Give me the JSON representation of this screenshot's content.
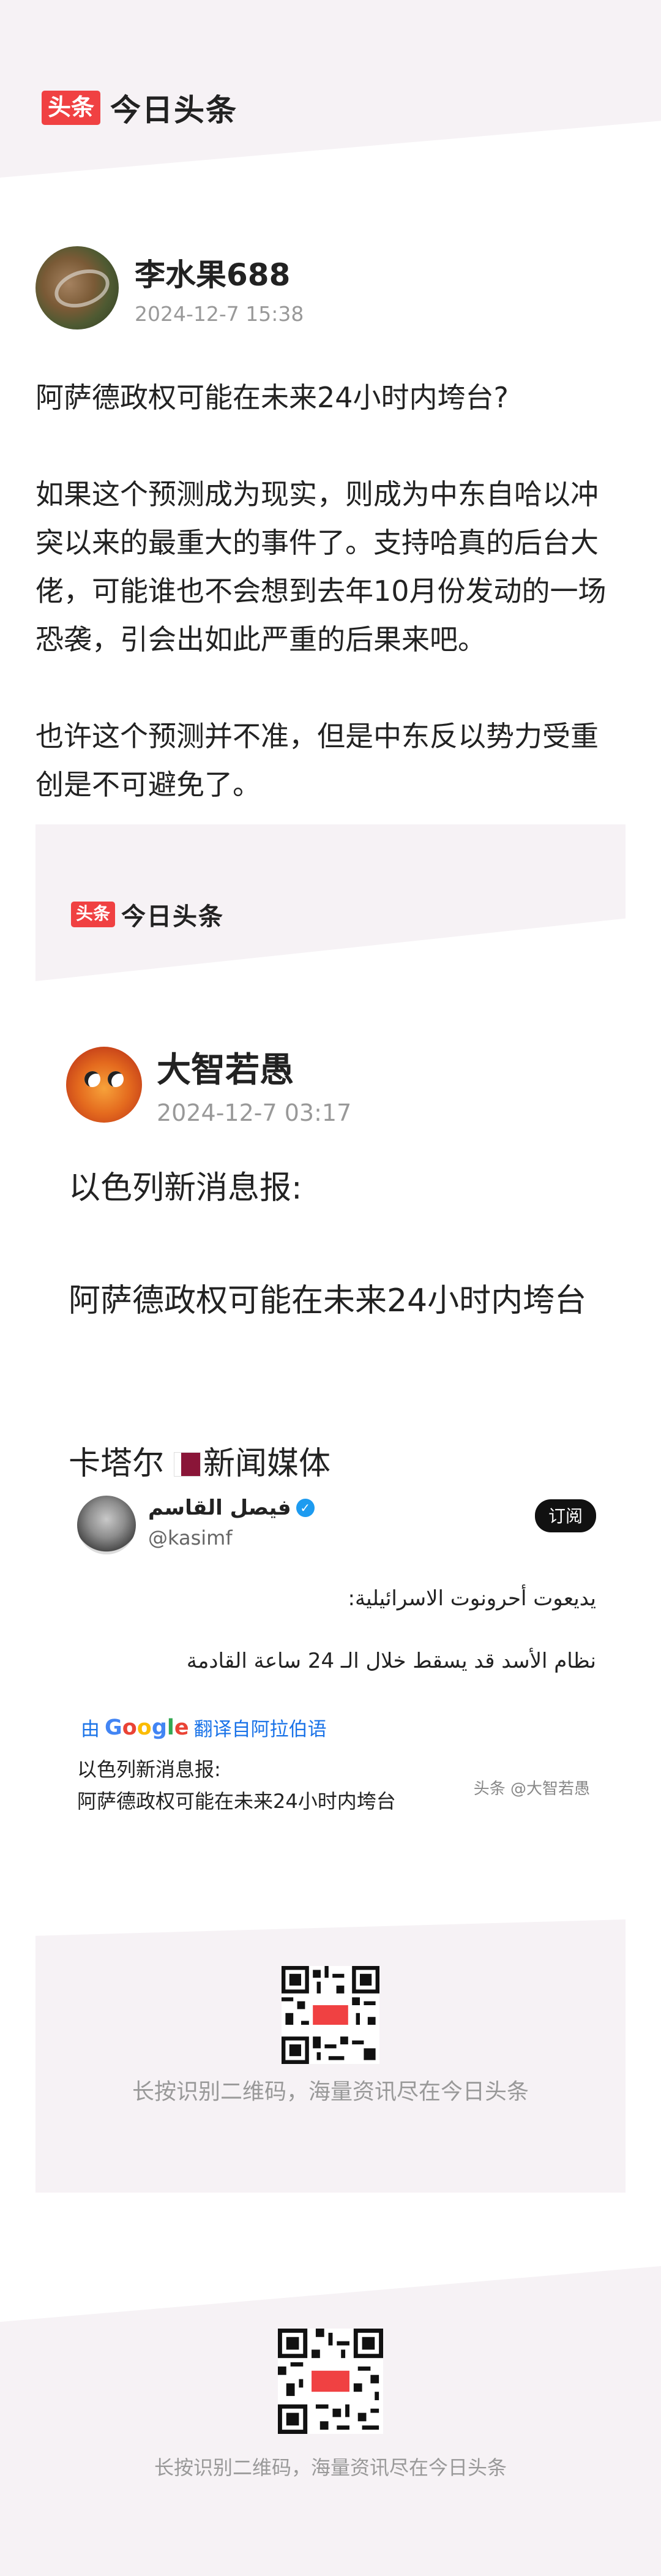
{
  "brand": {
    "badge": "头条",
    "name": "今日头条"
  },
  "post": {
    "author_name": "李水果688",
    "time": "2024-12-7 15:38",
    "paragraphs": [
      "阿萨德政权可能在未来24小时内垮台?",
      "如果这个预测成为现实，则成为中东自哈以冲突以来的最重大的事件了。支持哈真的后台大佬，可能谁也不会想到去年10月份发动的一场恐袭，引会出如此严重的后果来吧。",
      "也许这个预测并不准，但是中东反以势力受重创是不可避免了。"
    ]
  },
  "quoted": {
    "brand_badge": "头条",
    "brand_name": "今日头条",
    "author_name": "大智若愚",
    "time": "2024-12-7 03:17",
    "line1": "以色列新消息报:",
    "line2": "阿萨德政权可能在未来24小时内垮台",
    "line3_prefix": "卡塔尔",
    "line3_suffix": "新闻媒体",
    "tweet": {
      "name": "فيصل القاسم",
      "handle": "@kasimf",
      "subscribe": "订阅",
      "ar_line1": "يديعوت أحرونوت الاسرائيلية:",
      "ar_line2": "نظام الأسد قد يسقط خلال الـ 24 ساعة القادمة",
      "translate_by": "由",
      "google": "Google",
      "translate_label": "翻译自阿拉伯语",
      "zh_line1": "以色列新消息报:",
      "zh_line2": "阿萨德政权可能在未来24小时内垮台",
      "watermark": "头条 @大智若愚"
    }
  },
  "qr": {
    "caption": "长按识别二维码，海量资讯尽在今日头条",
    "badge": "头条"
  },
  "colors": {
    "brand_red": "#f04142",
    "band": "#f6f2f5",
    "meta_gray": "#999999"
  }
}
